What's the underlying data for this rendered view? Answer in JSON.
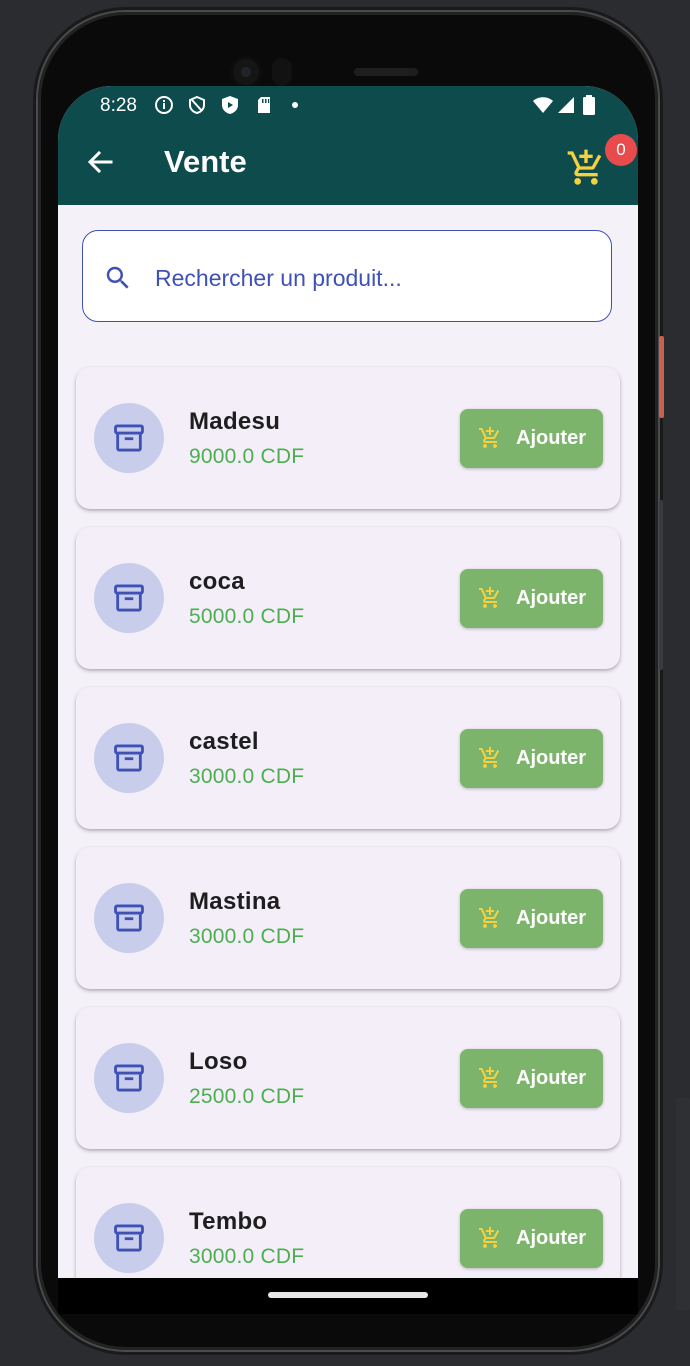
{
  "status_bar": {
    "time": "8:28"
  },
  "app_bar": {
    "title": "Vente",
    "cart_count": "0"
  },
  "search": {
    "placeholder": "Rechercher un produit...",
    "value": ""
  },
  "products": [
    {
      "name": "Madesu",
      "price": "9000.0 CDF",
      "button": "Ajouter"
    },
    {
      "name": "coca",
      "price": "5000.0 CDF",
      "button": "Ajouter"
    },
    {
      "name": "castel",
      "price": "3000.0 CDF",
      "button": "Ajouter"
    },
    {
      "name": "Mastina",
      "price": "3000.0 CDF",
      "button": "Ajouter"
    },
    {
      "name": "Loso",
      "price": "2500.0 CDF",
      "button": "Ajouter"
    },
    {
      "name": "Tembo",
      "price": "3000.0 CDF",
      "button": "Ajouter"
    }
  ],
  "colors": {
    "app_bar": "#0e4b4d",
    "accent": "#3f51b5",
    "price": "#4caf50",
    "add_button": "#7cb46b",
    "cart_icon": "#f5d142",
    "badge": "#e84b4b"
  },
  "icons": {
    "back": "arrow-back-icon",
    "cart": "add-shopping-cart-icon",
    "search": "search-icon",
    "product": "archive-box-icon"
  }
}
